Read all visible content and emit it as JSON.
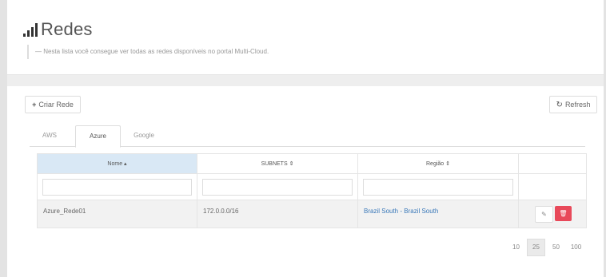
{
  "header": {
    "title": "Redes",
    "icon": "signal-bars-icon",
    "description": "Nesta lista você consegue ver todas as redes disponíveis no portal Multi-Cloud."
  },
  "toolbar": {
    "create_label": "Criar Rede",
    "refresh_label": "Refresh"
  },
  "tabs": [
    {
      "label": "AWS",
      "active": false
    },
    {
      "label": "Azure",
      "active": true
    },
    {
      "label": "Google",
      "active": false
    }
  ],
  "table": {
    "columns": [
      {
        "label": "Nome ▴",
        "sorted": true
      },
      {
        "label": "SUBNETS ⇕",
        "sorted": false
      },
      {
        "label": "Região ⇕",
        "sorted": false
      },
      {
        "label": "",
        "sorted": false
      }
    ],
    "rows": [
      {
        "name": "Azure_Rede01",
        "subnets": "172.0.0.0/16",
        "region": "Brazil South - Brazil South"
      }
    ]
  },
  "pagination": {
    "options": [
      "10",
      "25",
      "50",
      "100"
    ],
    "selected": "25"
  },
  "colors": {
    "accent": "#3b79b9",
    "delete": "#e8495a",
    "sorted_header": "#d9e8f5"
  }
}
